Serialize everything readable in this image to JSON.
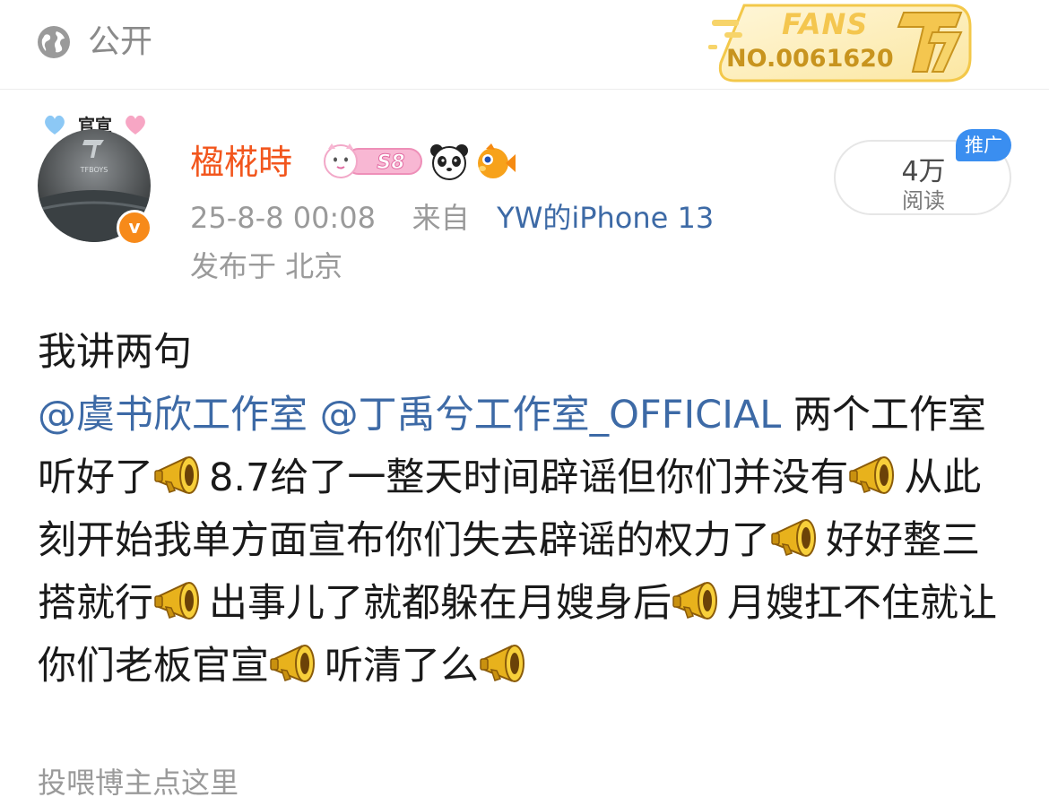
{
  "visibility": {
    "icon": "globe-icon",
    "label": "公开"
  },
  "fans_badge": {
    "word": "FANS",
    "number": "NO.0061620",
    "logo_icon": "tf-logo-icon"
  },
  "author": {
    "official_tag": "官宣",
    "name": "楹椛時",
    "level_badge": "S8",
    "verified_mark": "v",
    "avatar_caption": "TFBOYS"
  },
  "meta": {
    "timestamp": "25-8-8 00:08",
    "source_prefix": "来自",
    "device": "YW的iPhone 13",
    "location": "发布于 北京"
  },
  "reads": {
    "count": "4万",
    "label": "阅读",
    "promo": "推广"
  },
  "post": {
    "line1": "我讲两句",
    "mention1": "@虞书欣工作室",
    "mention2": "@丁禹兮工作室_OFFICIAL",
    "seg1": "两个工作室听好了",
    "seg2": "8.7给了一整天时间辟谣但你们并没有",
    "seg3": "从此刻开始我单方面宣布你们失去辟谣的权力了",
    "seg4": "好好整三搭就行",
    "seg5": "出事儿了就都躲在月嫂身后",
    "seg6": "月嫂扛不住就让你们老板官宣",
    "seg7": "听清了么"
  },
  "footer": {
    "tip": "投喂博主点这里"
  },
  "colors": {
    "name": "#f2561d",
    "link": "#3d6aa6",
    "secondary": "#9a9a9a",
    "badge_gold": "#f4c64f",
    "promo_blue": "#3a8ef0",
    "verified_orange": "#f78a1a"
  }
}
